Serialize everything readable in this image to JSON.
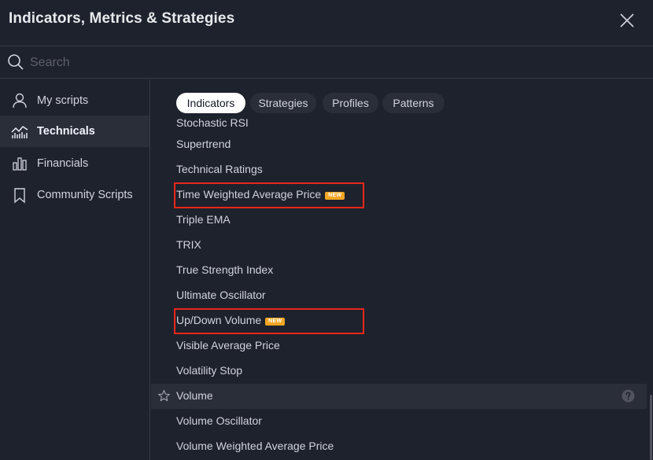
{
  "header": {
    "title": "Indicators, Metrics & Strategies"
  },
  "search": {
    "placeholder": "Search"
  },
  "sidebar": {
    "items": [
      {
        "label": "My scripts",
        "icon": "user-icon",
        "active": false
      },
      {
        "label": "Technicals",
        "icon": "chart-icon",
        "active": true
      },
      {
        "label": "Financials",
        "icon": "bar-chart-icon",
        "active": false
      },
      {
        "label": "Community Scripts",
        "icon": "bookmark-icon",
        "active": false
      }
    ]
  },
  "tabs": [
    {
      "label": "Indicators",
      "active": true
    },
    {
      "label": "Strategies",
      "active": false
    },
    {
      "label": "Profiles",
      "active": false
    },
    {
      "label": "Patterns",
      "active": false
    }
  ],
  "list": [
    {
      "label": "Stochastic RSI"
    },
    {
      "label": "Supertrend"
    },
    {
      "label": "Technical Ratings"
    },
    {
      "label": "Time Weighted Average Price",
      "badge": "NEW"
    },
    {
      "label": "Triple EMA"
    },
    {
      "label": "TRIX"
    },
    {
      "label": "True Strength Index"
    },
    {
      "label": "Ultimate Oscillator"
    },
    {
      "label": "Up/Down Volume",
      "badge": "NEW"
    },
    {
      "label": "Visible Average Price"
    },
    {
      "label": "Volatility Stop"
    },
    {
      "label": "Volume",
      "hovered": true
    },
    {
      "label": "Volume Oscillator"
    },
    {
      "label": "Volume Weighted Average Price"
    }
  ],
  "colors": {
    "badge": "#f5a623",
    "highlight": "#e8271a",
    "background": "#1e222d",
    "active_bg": "#2a2e39"
  }
}
